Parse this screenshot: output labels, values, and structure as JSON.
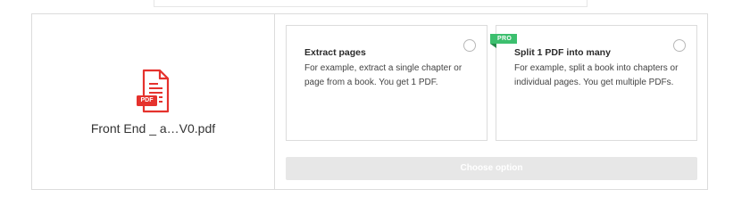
{
  "file": {
    "name": "Front End _ a…V0.pdf",
    "icon": "pdf-file-icon",
    "icon_label": "PDF",
    "icon_color": "#e5322d"
  },
  "options": [
    {
      "title": "Extract pages",
      "description": "For example, extract a single chapter or page from a book. You get 1 PDF.",
      "selected": false
    },
    {
      "title": "Split 1 PDF into many",
      "description": "For example, split a book into chapters or individual pages. You get multiple PDFs.",
      "badge": "PRO",
      "badge_color": "#3cbf6e",
      "selected": false
    }
  ],
  "action": {
    "label": "Choose option",
    "enabled": false
  }
}
